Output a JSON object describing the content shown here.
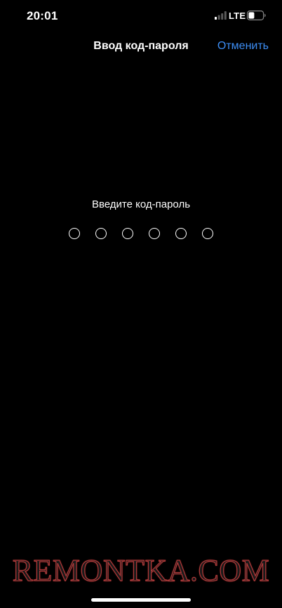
{
  "status_bar": {
    "time": "20:01",
    "network": "LTE",
    "icons": [
      "cellular-signal-icon",
      "battery-icon"
    ]
  },
  "nav": {
    "title": "Ввод код-пароля",
    "cancel_label": "Отменить"
  },
  "prompt": {
    "text": "Введите код-пароль",
    "digit_count": 6,
    "digits_entered": 0
  },
  "watermark": {
    "text": "REMONTKA.COM"
  },
  "colors": {
    "background": "#000000",
    "text": "#ffffff",
    "accent": "#3d8ef5"
  }
}
